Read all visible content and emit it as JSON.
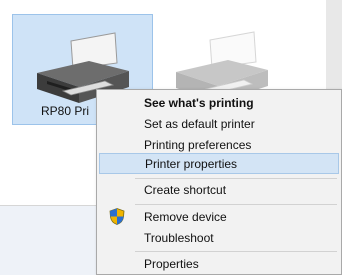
{
  "devices": [
    {
      "label": "RP80 Pri",
      "icon": "printer-icon",
      "selected": true
    },
    {
      "label": "",
      "icon": "printer-icon",
      "selected": false
    }
  ],
  "context_menu": {
    "items": [
      {
        "label": "See what's printing",
        "bold": true
      },
      {
        "label": "Set as default printer"
      },
      {
        "label": "Printing preferences"
      },
      {
        "label": "Printer properties",
        "highlighted": true
      },
      {
        "label": "Create shortcut"
      },
      {
        "label": "Remove device",
        "icon": "shield-icon"
      },
      {
        "label": "Troubleshoot"
      },
      {
        "label": "Properties"
      }
    ]
  },
  "colors": {
    "selection_fill": "#cfe3f7",
    "selection_border": "#9cc3ea",
    "menu_background": "#f2f2f2",
    "menu_highlight": "#d3e4f5"
  }
}
